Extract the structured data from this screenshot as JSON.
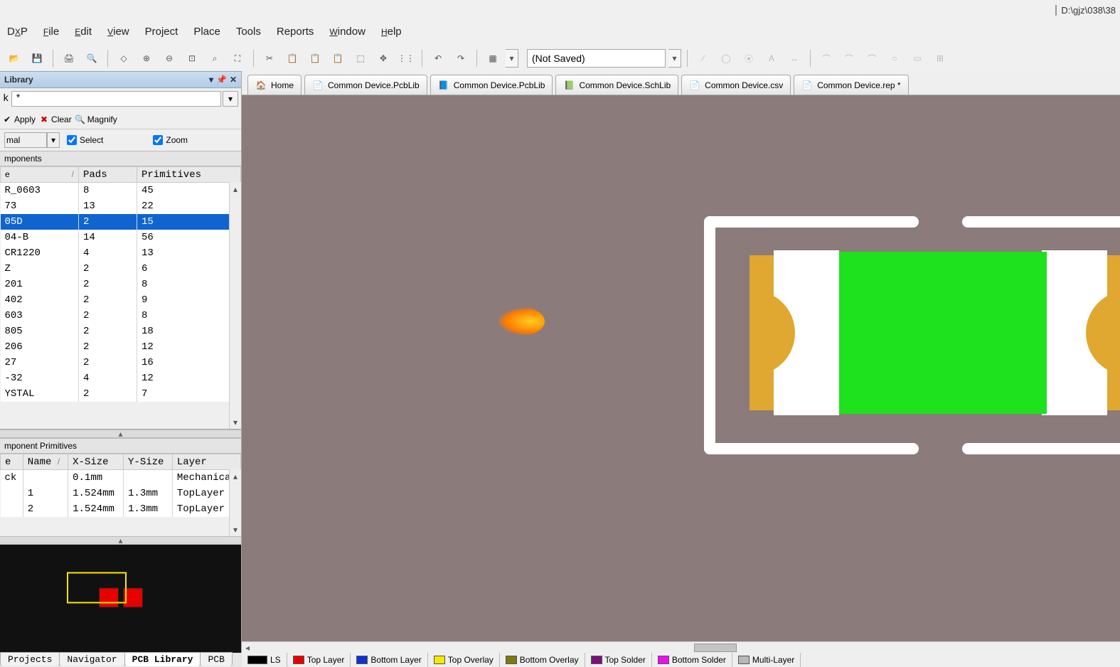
{
  "title_path": "D:\\gjz\\038\\38",
  "menu": [
    "DXP",
    "File",
    "Edit",
    "View",
    "Project",
    "Place",
    "Tools",
    "Reports",
    "Window",
    "Help"
  ],
  "menu_accel": [
    "X",
    "F",
    "E",
    "V",
    "",
    "",
    "",
    "",
    "W",
    "H"
  ],
  "toolbar_saved": "(Not Saved)",
  "panel": {
    "title": "Library",
    "filter_value": "*",
    "apply": "Apply",
    "clear": "Clear",
    "magnify": "Magnify",
    "combo": "mal",
    "select_label": "Select",
    "zoom_label": "Zoom",
    "components_hdr": "mponents",
    "col_name": "e",
    "col_pads": "Pads",
    "col_prim": "Primitives",
    "rows": [
      {
        "n": "R_0603",
        "p": "8",
        "r": "45"
      },
      {
        "n": "73",
        "p": "13",
        "r": "22"
      },
      {
        "n": "05D",
        "p": "2",
        "r": "15",
        "sel": true
      },
      {
        "n": "04-B",
        "p": "14",
        "r": "56"
      },
      {
        "n": "CR1220",
        "p": "4",
        "r": "13"
      },
      {
        "n": "Z",
        "p": "2",
        "r": "6"
      },
      {
        "n": "201",
        "p": "2",
        "r": "8"
      },
      {
        "n": "402",
        "p": "2",
        "r": "9"
      },
      {
        "n": "603",
        "p": "2",
        "r": "8"
      },
      {
        "n": "805",
        "p": "2",
        "r": "18"
      },
      {
        "n": "206",
        "p": "2",
        "r": "12"
      },
      {
        "n": "27",
        "p": "2",
        "r": "16"
      },
      {
        "n": "-32",
        "p": "4",
        "r": "12"
      },
      {
        "n": "YSTAL",
        "p": "2",
        "r": "7"
      }
    ],
    "prim_hdr": "mponent Primitives",
    "prim_cols": [
      "e",
      "Name",
      "X-Size",
      "Y-Size",
      "Layer"
    ],
    "prim_rows": [
      {
        "t": "ck",
        "n": "",
        "x": "0.1mm",
        "y": "",
        "l": "Mechanica"
      },
      {
        "t": "",
        "n": "1",
        "x": "1.524mm",
        "y": "1.3mm",
        "l": "TopLayer"
      },
      {
        "t": "",
        "n": "2",
        "x": "1.524mm",
        "y": "1.3mm",
        "l": "TopLayer"
      }
    ]
  },
  "bottom_tabs": [
    "Projects",
    "Navigator",
    "PCB Library",
    "PCB"
  ],
  "bottom_tab_active": 2,
  "doc_tabs": [
    {
      "label": "Home",
      "icon": "🏠"
    },
    {
      "label": "Common Device.PcbLib",
      "icon": "📄"
    },
    {
      "label": "Common Device.PcbLib",
      "icon": "📘"
    },
    {
      "label": "Common Device.SchLib",
      "icon": "📗"
    },
    {
      "label": "Common Device.csv",
      "icon": "📄"
    },
    {
      "label": "Common Device.rep *",
      "icon": "📄"
    }
  ],
  "layers": [
    {
      "name": "LS",
      "color": "#000000"
    },
    {
      "name": "Top Layer",
      "color": "#e60000"
    },
    {
      "name": "Bottom Layer",
      "color": "#1030d0"
    },
    {
      "name": "Top Overlay",
      "color": "#f5e900"
    },
    {
      "name": "Bottom Overlay",
      "color": "#7a7a10"
    },
    {
      "name": "Top Solder",
      "color": "#7a107a"
    },
    {
      "name": "Bottom Solder",
      "color": "#e810e8"
    },
    {
      "name": "Multi-Layer",
      "color": "#b8b8b8"
    }
  ]
}
